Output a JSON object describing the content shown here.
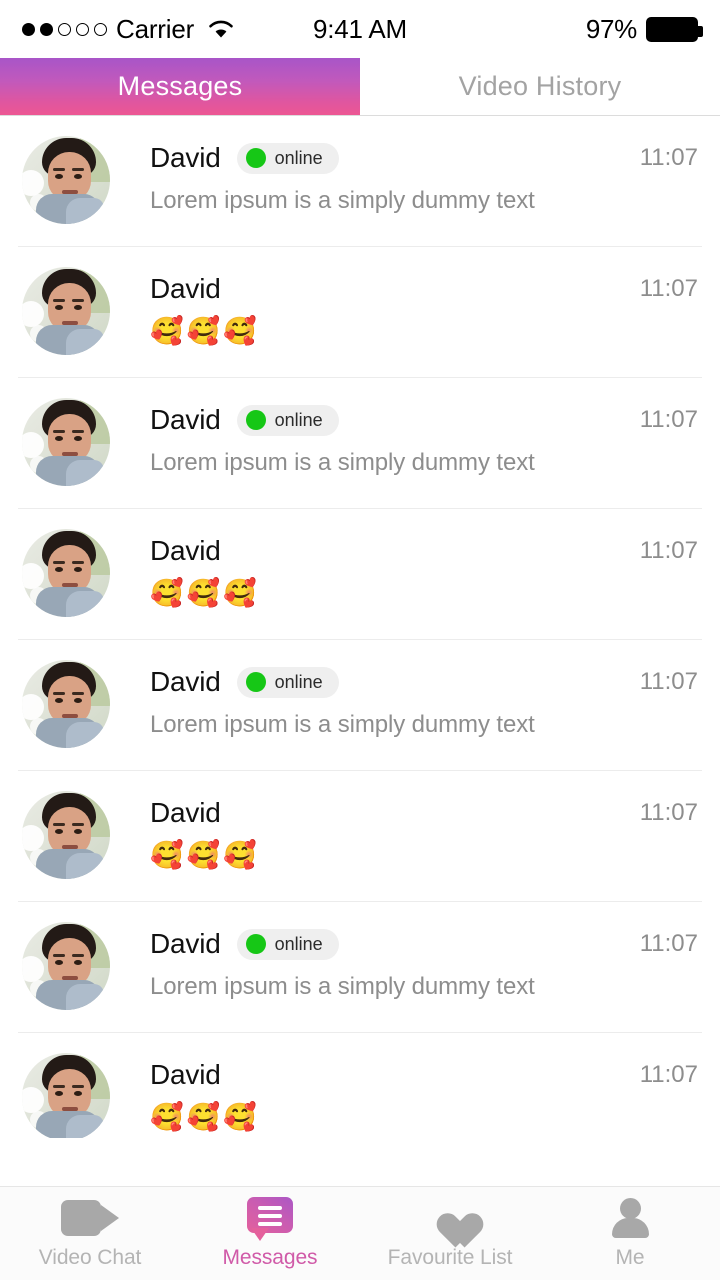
{
  "status_bar": {
    "signal_dots_filled": 2,
    "signal_dots_total": 5,
    "carrier": "Carrier",
    "wifi_icon": "wifi-icon",
    "time": "9:41 AM",
    "battery_percent": "97%",
    "battery_icon": "battery-full-icon"
  },
  "top_tabs": {
    "active_index": 0,
    "items": [
      {
        "label": "Messages",
        "active": true
      },
      {
        "label": "Video History",
        "active": false
      }
    ],
    "active_gradient_from": "#a855c8",
    "active_gradient_to": "#ec5793",
    "inactive_color": "#a3a3a3"
  },
  "messages": {
    "status_online_label": "online",
    "status_online_color": "#16c716",
    "rows": [
      {
        "name": "David",
        "online": true,
        "preview": "Lorem ipsum is a simply dummy text",
        "emojis": "",
        "time": "11:07"
      },
      {
        "name": "David",
        "online": false,
        "preview": "",
        "emojis": "🥰🥰🥰",
        "time": "11:07"
      },
      {
        "name": "David",
        "online": true,
        "preview": "Lorem ipsum is a simply dummy text",
        "emojis": "",
        "time": "11:07"
      },
      {
        "name": "David",
        "online": false,
        "preview": "",
        "emojis": "🥰🥰🥰",
        "time": "11:07"
      },
      {
        "name": "David",
        "online": true,
        "preview": "Lorem ipsum is a simply dummy text",
        "emojis": "",
        "time": "11:07"
      },
      {
        "name": "David",
        "online": false,
        "preview": "",
        "emojis": "🥰🥰🥰",
        "time": "11:07"
      },
      {
        "name": "David",
        "online": true,
        "preview": "Lorem ipsum is a simply dummy text",
        "emojis": "",
        "time": "11:07"
      },
      {
        "name": "David",
        "online": false,
        "preview": "",
        "emojis": "🥰🥰🥰",
        "time": "11:07"
      }
    ]
  },
  "bottom_nav": {
    "active_index": 1,
    "active_color": "#d05aa8",
    "inactive_color": "#b4b4b4",
    "items": [
      {
        "label": "Video Chat",
        "icon": "video-camera-icon",
        "active": false
      },
      {
        "label": "Messages",
        "icon": "message-bubble-icon",
        "active": true
      },
      {
        "label": "Favourite List",
        "icon": "heart-icon",
        "active": false
      },
      {
        "label": "Me",
        "icon": "person-icon",
        "active": false
      }
    ]
  }
}
